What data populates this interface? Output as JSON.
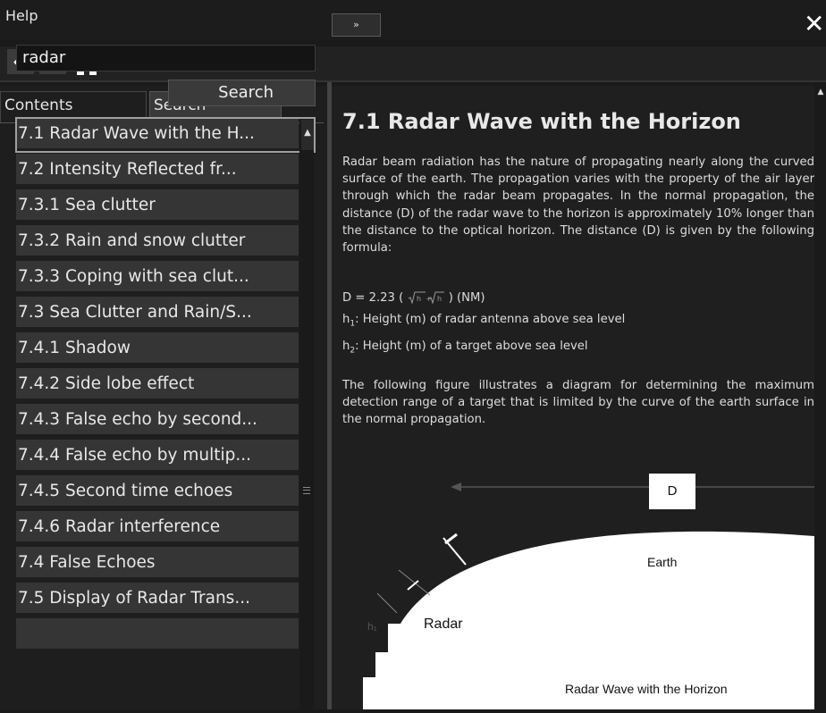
{
  "window": {
    "title": "Help",
    "toggle_label": "»",
    "close_label": "✕"
  },
  "nav": {
    "back_label": "←",
    "forward_label": "→"
  },
  "tabs": {
    "contents": "Contents",
    "search": "Search"
  },
  "search": {
    "query": "radar",
    "button_label": "Search"
  },
  "results": [
    "7.1 Radar Wave with the H...",
    "7.2 Intensity Reflected fr...",
    "7.3.1 Sea clutter",
    "7.3.2 Rain and snow clutter",
    "7.3.3 Coping with sea clut...",
    "7.3 Sea Clutter and Rain/S...",
    "7.4.1 Shadow",
    "7.4.2 Side lobe effect",
    "7.4.3 False echo by second...",
    "7.4.4 False echo by multip...",
    "7.4.5 Second time echoes",
    "7.4.6 Radar interference",
    "7.4 False Echoes",
    "7.5 Display of Radar Trans..."
  ],
  "article": {
    "heading": "7.1   Radar Wave with the Horizon",
    "para1": "Radar beam radiation has the nature of propagating nearly along the curved surface of the earth. The propagation varies with the property of the air layer through which the radar beam propagates. In the normal propagation, the distance (D) of the radar wave to the horizon is approximately 10% longer than the distance to the optical horizon. The distance (D) is given by the following formula:",
    "formula_prefix": "D = 2.23 (",
    "formula_suffix": ") (NM)",
    "h1_label": "h",
    "h1_sub": "1",
    "h1_text": ": Height (m) of radar antenna above sea level",
    "h2_label": "h",
    "h2_sub": "2",
    "h2_text": ": Height (m) of a target above sea level",
    "para2": "The following figure illustrates a diagram for determining the maximum detection range of a target that is limited by the curve of the earth surface in the normal propagation."
  },
  "figure": {
    "d_label": "D",
    "earth_label": "Earth",
    "radar_label": "Radar",
    "h1_label": "h₁",
    "caption": "Radar Wave with the Horizon"
  }
}
